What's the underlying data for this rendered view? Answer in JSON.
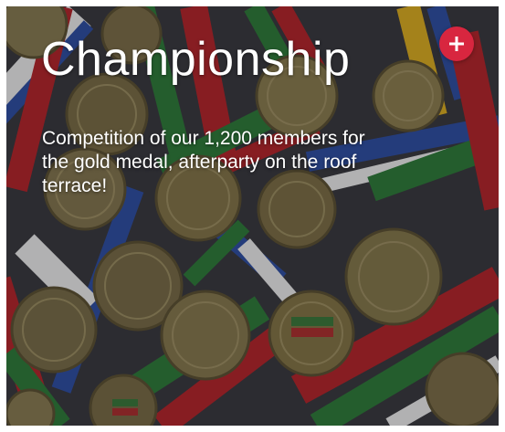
{
  "card": {
    "title": "Championship",
    "description": "Competition of our 1,200 members for the gold medal, afterparty on the roof terrace!",
    "photo_icon": "medals-photo",
    "action_icon": "plus-icon"
  },
  "colors": {
    "accent": "#d8263f",
    "text": "#ffffff",
    "ribbon_red": "#b8242a",
    "ribbon_green": "#2e7d3a",
    "ribbon_blue": "#2f4fa6",
    "medal_gold": "#8a7a4a"
  }
}
